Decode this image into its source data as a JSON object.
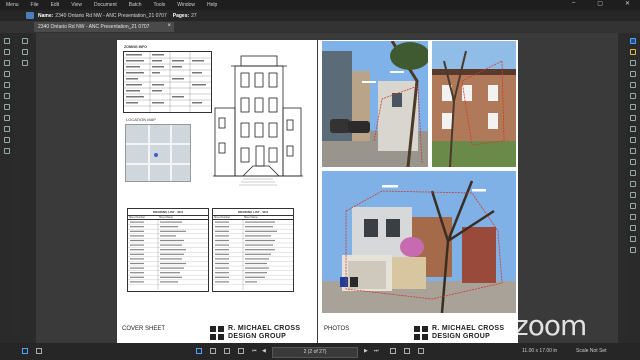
{
  "menu": [
    "Menu",
    "File",
    "Edit",
    "View",
    "Document",
    "Batch",
    "Tools",
    "Window",
    "Help"
  ],
  "info": {
    "name_label": "Name:",
    "name_value": "2340 Ontario Rd NW - ANC Presentation_21 0707",
    "pages_label": "Pages:",
    "pages_value": "27"
  },
  "tab": {
    "title": "2340 Ontario Rd NW - ANC Presentation_21 0707"
  },
  "page1": {
    "zoning_title": "ZONING INFO",
    "location_title": "LOCATION MAP",
    "list1_title": "DRAWING LIST - SD1",
    "list2_title": "DRAWING LIST - SD1",
    "col_sheet": "Sheet Number",
    "col_name": "Sheet Name",
    "sheet_label": "COVER SHEET"
  },
  "page2": {
    "sheet_label": "PHOTOS"
  },
  "logo": {
    "line1": "R. MICHAEL CROSS",
    "line2": "DESIGN GROUP"
  },
  "bottom": {
    "page_nav": "2 (2 of 27)",
    "size": "11.00 x 17.00 in",
    "scale": "Scale Not Set"
  },
  "watermark": "zoom"
}
